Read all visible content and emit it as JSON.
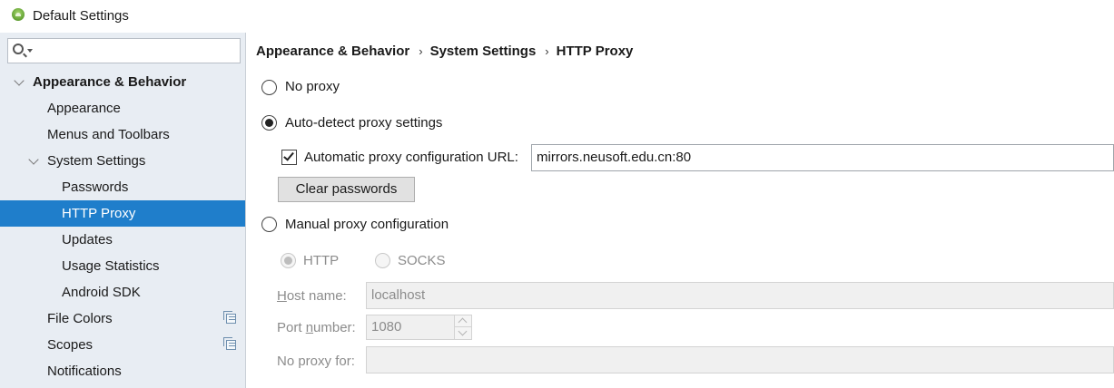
{
  "window": {
    "title": "Default Settings",
    "icon": "android-studio-icon"
  },
  "sidebar": {
    "search": {
      "value": "",
      "placeholder": ""
    },
    "items": [
      {
        "label": "Appearance & Behavior",
        "level": 0,
        "expanded": true,
        "bold": true
      },
      {
        "label": "Appearance",
        "level": 1
      },
      {
        "label": "Menus and Toolbars",
        "level": 1
      },
      {
        "label": "System Settings",
        "level": 1,
        "expanded": true
      },
      {
        "label": "Passwords",
        "level": 2
      },
      {
        "label": "HTTP Proxy",
        "level": 2,
        "selected": true
      },
      {
        "label": "Updates",
        "level": 2
      },
      {
        "label": "Usage Statistics",
        "level": 2
      },
      {
        "label": "Android SDK",
        "level": 2
      },
      {
        "label": "File Colors",
        "level": 1,
        "icon": "copy-settings-icon"
      },
      {
        "label": "Scopes",
        "level": 1,
        "icon": "copy-settings-icon"
      },
      {
        "label": "Notifications",
        "level": 1
      }
    ]
  },
  "breadcrumb": {
    "items": [
      "Appearance & Behavior",
      "System Settings",
      "HTTP Proxy"
    ],
    "separator": "›"
  },
  "proxy": {
    "no_proxy_label": "No proxy",
    "auto_detect_label": "Auto-detect proxy settings",
    "auto_config_url_label": "Automatic proxy configuration URL:",
    "auto_config_url_checked": true,
    "auto_config_url_value": "mirrors.neusoft.edu.cn:80",
    "clear_passwords_label": "Clear passwords",
    "manual_label": "Manual proxy configuration",
    "selected_mode": "auto-detect",
    "protocol": {
      "http_label": "HTTP",
      "socks_label": "SOCKS",
      "selected": "HTTP"
    },
    "host_name_label_pre": "",
    "host_name_label_mnemonic": "H",
    "host_name_label_post": "ost name:",
    "host_name_value": "localhost",
    "port_label_pre": "Port ",
    "port_label_mnemonic": "n",
    "port_label_post": "umber:",
    "port_value": "1080",
    "no_proxy_for_label": "No proxy for:",
    "no_proxy_for_value": ""
  },
  "colors": {
    "selection": "#1f7ecb",
    "sidebar_bg": "#e8edf3"
  }
}
